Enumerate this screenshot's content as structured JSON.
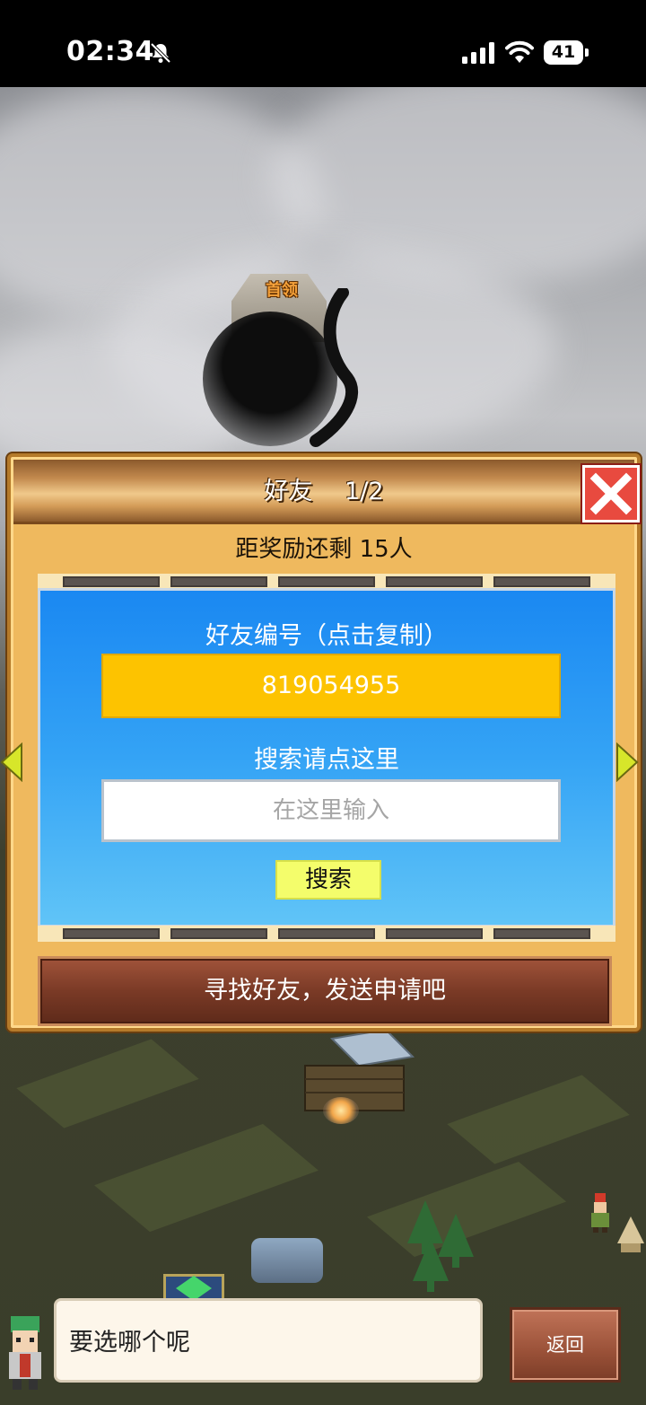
{
  "status_bar": {
    "time": "02:34",
    "battery": "41",
    "icons": [
      "bell-slash-icon",
      "signal-icon",
      "wifi-icon",
      "battery-icon"
    ]
  },
  "map": {
    "boss_label": "首领"
  },
  "dialog": {
    "title": "好友　 1/2",
    "reward_text": "距奖励还剩 15人",
    "friend_id_label": "好友编号（点击复制）",
    "friend_id": "819054955",
    "search_label": "搜索请点这里",
    "search_placeholder": "在这里输入",
    "search_button": "搜索",
    "find_friends_button": "寻找好友，发送申请吧",
    "close_icon": "close-icon",
    "prev_icon": "arrow-left-icon",
    "next_icon": "arrow-right-icon"
  },
  "bottom": {
    "speech": "要选哪个呢",
    "back_button": "返回"
  },
  "colors": {
    "panel_bg": "#efb95e",
    "blue_box": "#34a3f5",
    "id_field": "#fdc300",
    "search_button": "#f4fd6b",
    "close_button": "#e84a3f",
    "find_button": "#7a3a26"
  }
}
